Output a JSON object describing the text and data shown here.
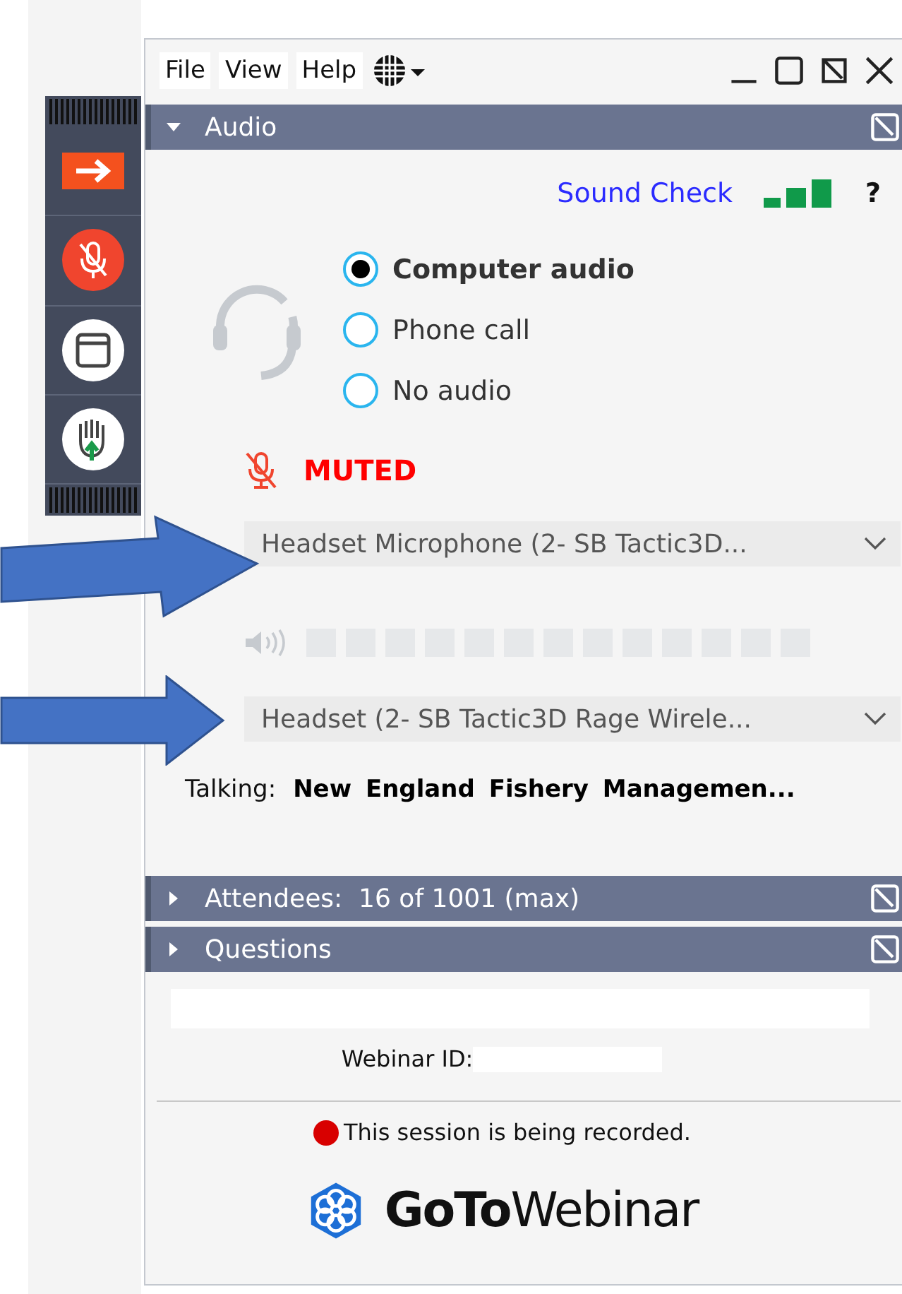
{
  "menu": [
    "File",
    "View",
    "Help"
  ],
  "toolbar": {
    "muted": true
  },
  "audio": {
    "title": "Audio",
    "expanded": true,
    "sound_check": "Sound Check",
    "help": "?",
    "options": [
      {
        "label": "Computer audio",
        "selected": true
      },
      {
        "label": "Phone call",
        "selected": false
      },
      {
        "label": "No audio",
        "selected": false
      }
    ],
    "muted": true,
    "muted_label": "MUTED",
    "microphone": "Headset Microphone (2- SB Tactic3D...",
    "speaker": "Headset (2- SB Tactic3D Rage Wirele...",
    "talking_label": "Talking:",
    "talking_name": "New England Fishery Managemen..."
  },
  "attendees": {
    "title": "Attendees:  16 of 1001 (max)",
    "expanded": false
  },
  "questions": {
    "title": "Questions",
    "expanded": false
  },
  "footer": {
    "webinar_id_label": "Webinar ID:",
    "recording": "This session is being recorded.",
    "logo_bold": "GoTo",
    "logo_light": "Webinar"
  }
}
